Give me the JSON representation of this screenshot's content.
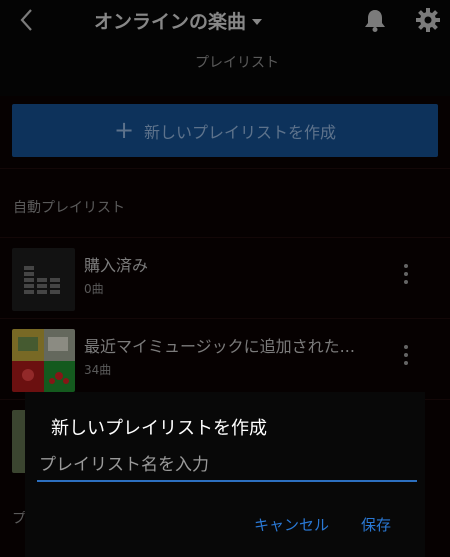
{
  "header": {
    "title": "オンラインの楽曲",
    "subtitle": "プレイリスト"
  },
  "create_button": {
    "plus": "+",
    "label": "新しいプレイリストを作成"
  },
  "auto_section": {
    "title": "自動プレイリスト",
    "items": [
      {
        "title": "購入済み",
        "count": "0曲",
        "thumb": "equalizer-icon"
      },
      {
        "title": "最近マイミュージックに追加された...",
        "count": "34曲",
        "thumb": "album-collage"
      }
    ],
    "partial_letter": "プ"
  },
  "dialog": {
    "title": "新しいプレイリストを作成",
    "placeholder": "プレイリスト名を入力",
    "value": "",
    "cancel_label": "キャンセル",
    "save_label": "保存"
  },
  "colors": {
    "accent": "#144d8c",
    "link": "#2a78d3"
  }
}
